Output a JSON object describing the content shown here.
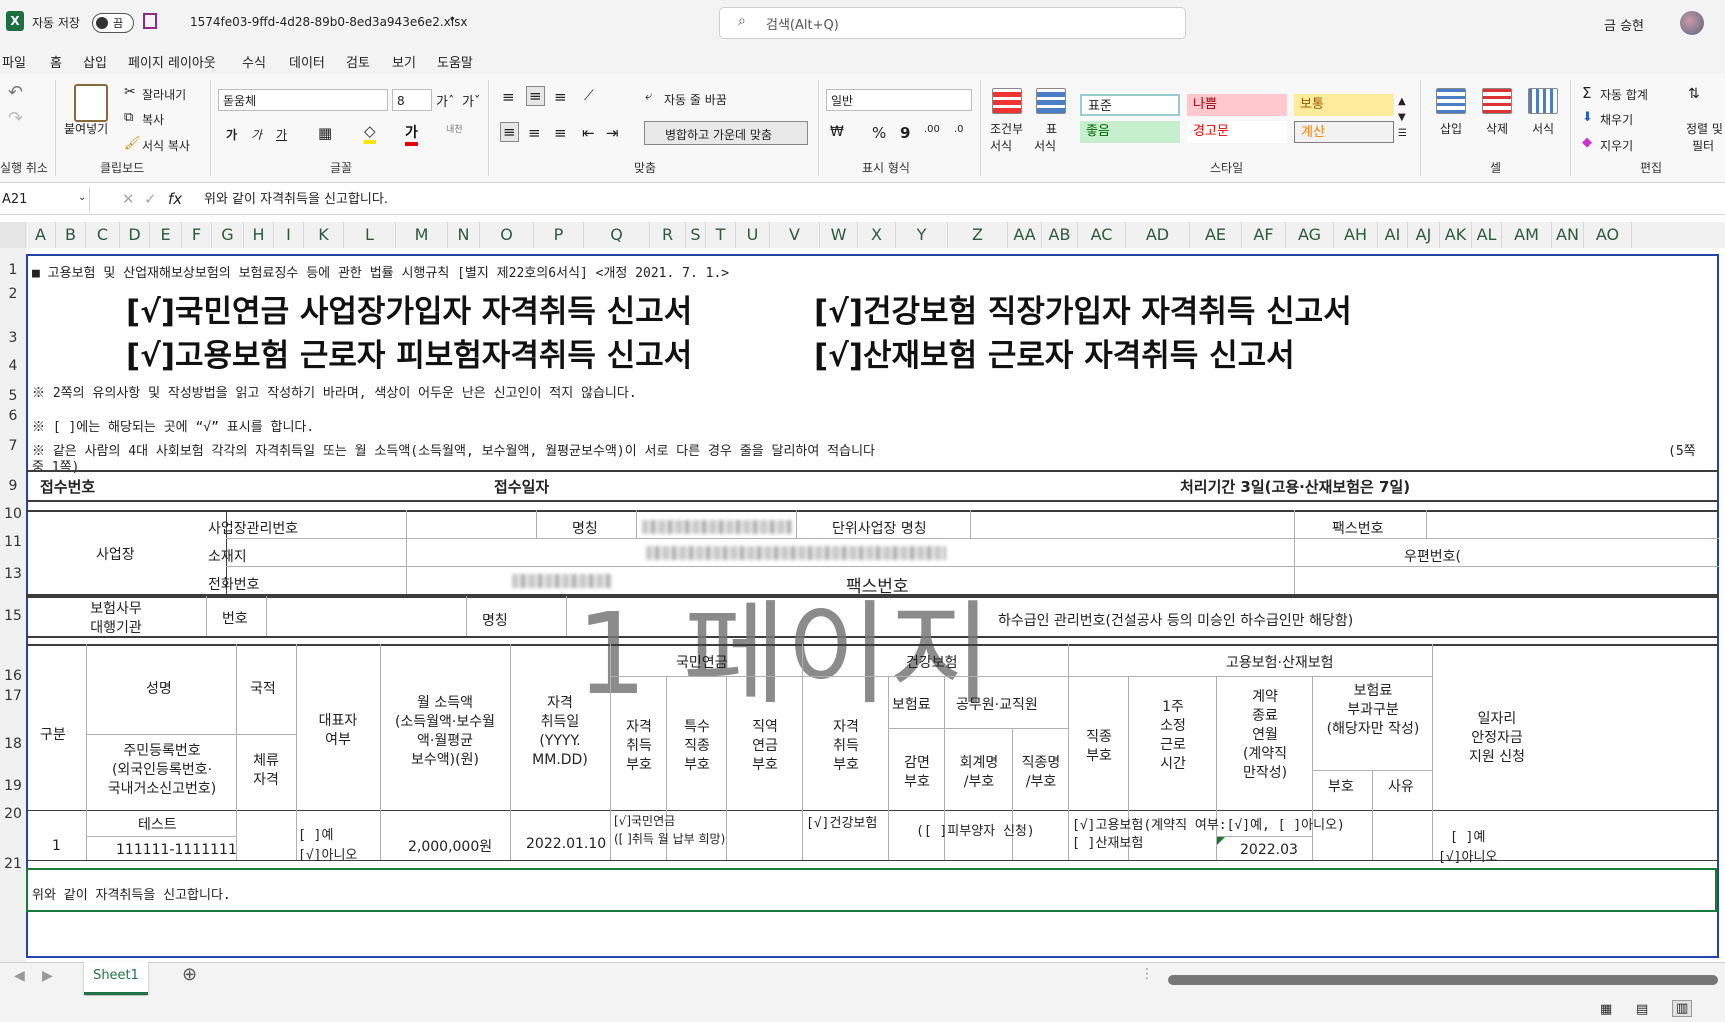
{
  "titlebar": {
    "autosave_label": "자동 저장",
    "autosave_state": "끔",
    "filename": "1574fe03-9ffd-4d28-89b0-8ed3a943e6e2.xlsx",
    "search_placeholder": "검색(Alt+Q)",
    "user": "금 승현"
  },
  "menu": [
    "파일",
    "홈",
    "삽입",
    "페이지 레이아웃",
    "수식",
    "데이터",
    "검토",
    "보기",
    "도움말"
  ],
  "ribbon": {
    "undo_label": "실행 취소",
    "clipboard": {
      "paste": "붙여넣기",
      "cut": "잘라내기",
      "copy": "복사",
      "format_painter": "서식 복사",
      "label": "클립보드"
    },
    "font": {
      "name": "돋움체",
      "size": "8",
      "bold": "가",
      "italic": "가",
      "underline": "가",
      "label": "글꼴"
    },
    "align": {
      "wrap": "자동 줄 바꿈",
      "merge": "병합하고 가운데 맞춤",
      "label": "맞춤"
    },
    "number": {
      "format": "일반",
      "label": "표시 형식"
    },
    "styles": {
      "cond": "조건부",
      "cond2": "서식",
      "table": "표",
      "table2": "서식",
      "normal": "표준",
      "bad": "나쁨",
      "neutral": "보통",
      "good": "좋음",
      "warning": "경고문",
      "calc": "계산",
      "label": "스타일"
    },
    "cells": {
      "insert": "삽입",
      "delete": "삭제",
      "format": "서식",
      "label": "셀"
    },
    "editing": {
      "autosum": "자동 합계",
      "fill": "채우기",
      "clear": "지우기",
      "sort": "정렬 및",
      "sort2": "필터",
      "label": "편집"
    }
  },
  "formula": {
    "namebox": "A21",
    "content": "위와 같이 자격취득을 신고합니다."
  },
  "columns": [
    "A",
    "B",
    "C",
    "D",
    "E",
    "F",
    "G",
    "H",
    "I",
    "K",
    "L",
    "M",
    "N",
    "O",
    "P",
    "Q",
    "R",
    "S",
    "T",
    "U",
    "V",
    "W",
    "X",
    "Y",
    "Z",
    "AA",
    "AB",
    "AC",
    "AD",
    "AE",
    "AF",
    "AG",
    "AH",
    "AI",
    "AJ",
    "AK",
    "AL",
    "AM",
    "AN",
    "AO"
  ],
  "rows": [
    "1",
    "2",
    "3",
    "4",
    "5",
    "6",
    "7",
    "9",
    "10",
    "11",
    "13",
    "15",
    "16",
    "17",
    "18",
    "19",
    "20",
    "21"
  ],
  "sheet": {
    "r1": "■ 고용보험 및 산업재해보상보험의 보험료징수 등에 관한 법률 시행규칙 [별지 제22호의6서식] <개정 2021. 7. 1.>",
    "t1": "[√]국민연금 사업장가입자 자격취득 신고서",
    "t2": "[√]건강보험 직장가입자 자격취득 신고서",
    "t3": "[√]고용보험 근로자 피보험자격취득 신고서",
    "t4": "[√]산재보험 근로자 자격취득 신고서",
    "r4": "※ 2쪽의 유의사항 및 작성방법을 읽고 작성하기 바라며, 색상이 어두운 난은 신고인이 적지 않습니다.",
    "r5": "※ [ ]에는 해당되는 곳에 “√” 표시를 합니다.",
    "r6": "※ 같은 사람의 4대 사회보험 각각의 자격취득일 또는 월 소득액(소득월액, 보수월액, 월평균보수액)이 서로 다른 경우 줄을 달리하여 적습니다",
    "r6b": "(5쪽",
    "r6c": "중 1쪽)",
    "recv_no": "접수번호",
    "recv_date": "접수일자",
    "proc": "처리기간 3일(고용·산재보험은 7일)",
    "biz": "사업장",
    "biz_id": "사업장관리번호",
    "name_lbl": "명칭",
    "unit_name": "단위사업장 명칭",
    "fax": "팩스번호",
    "addr": "소재지",
    "zip": "우편번호(",
    "phone": "전화번호",
    "fax2": "팩스번호",
    "agency1": "보험사무",
    "agency2": "대행기관",
    "num": "번호",
    "name2": "명칭",
    "sub": "하수급인 관리번호(건설공사 등의 미승인 하수급인만 해당함)",
    "watermark": "1 페이지",
    "h_gubun": "구분",
    "h_name": "성명",
    "h_nation": "국적",
    "h_resident": "주민등록번호",
    "h_resident2": "(외국인등록번호·",
    "h_resident3": "국내거소신고번호)",
    "h_stay1": "체류",
    "h_stay2": "자격",
    "h_rep1": "대표자",
    "h_rep2": "여부",
    "h_inc1": "월 소득액",
    "h_inc2": "(소득월액·보수월",
    "h_inc3": "액·월평균",
    "h_inc4": "보수액)(원)",
    "h_date1": "자격",
    "h_date2": "취득일",
    "h_date3": "(YYYY.",
    "h_date4": "MM.DD)",
    "h_np": "국민연금",
    "h_np1a": "자격",
    "h_np1b": "취득",
    "h_np1c": "부호",
    "h_np2a": "특수",
    "h_np2b": "직종",
    "h_np2c": "부호",
    "h_np3a": "직역",
    "h_np3b": "연금",
    "h_np3c": "부호",
    "h_hi": "건강보험",
    "h_hi1a": "자격",
    "h_hi1b": "취득",
    "h_hi1c": "부호",
    "h_hi2": "보험료",
    "h_hi3": "공무원·교직원",
    "h_hi4a": "감면",
    "h_hi4b": "부호",
    "h_hi5a": "회계명",
    "h_hi5b": "/부호",
    "h_hi6a": "직종명",
    "h_hi6b": "/부호",
    "h_ei": "고용보험·산재보험",
    "h_ei1a": "직종",
    "h_ei1b": "부호",
    "h_ei2a": "1주",
    "h_ei2b": "소정",
    "h_ei2c": "근로",
    "h_ei2d": "시간",
    "h_ei3a": "계약",
    "h_ei3b": "종료",
    "h_ei3c": "연월",
    "h_ei3d": "(계약직",
    "h_ei3e": "만작성)",
    "h_ei4a": "보험료",
    "h_ei4b": "부과구분",
    "h_ei4c": "(해당자만 작성)",
    "h_ei4d": "부호",
    "h_ei4e": "사유",
    "h_job1": "일자리",
    "h_job2": "안정자금",
    "h_job3": "지원 신청",
    "d_no": "1",
    "d_name": "테스트",
    "d_id": "111111-1111111",
    "d_rep1": "[  ]예",
    "d_rep2": "[√]아니오",
    "d_income": "2,000,000원",
    "d_date": "2022.01.10",
    "d_np1": "[√]국민연금",
    "d_np2": "([ ]취득 월 납부 희망)",
    "d_hi": "[√]건강보험",
    "d_hi2": "([ ]피부양자 신청)",
    "d_ei1": "[√]고용보험(계약직 여부:[√]예, [  ]아니오)",
    "d_ei2": "[ ]산재보험",
    "d_end": "2022.03",
    "d_job1": "[  ]예",
    "d_job2": "[√]아니오",
    "r21": "위와 같이 자격취득을 신고합니다."
  },
  "tabs": {
    "sheet1": "Sheet1"
  }
}
